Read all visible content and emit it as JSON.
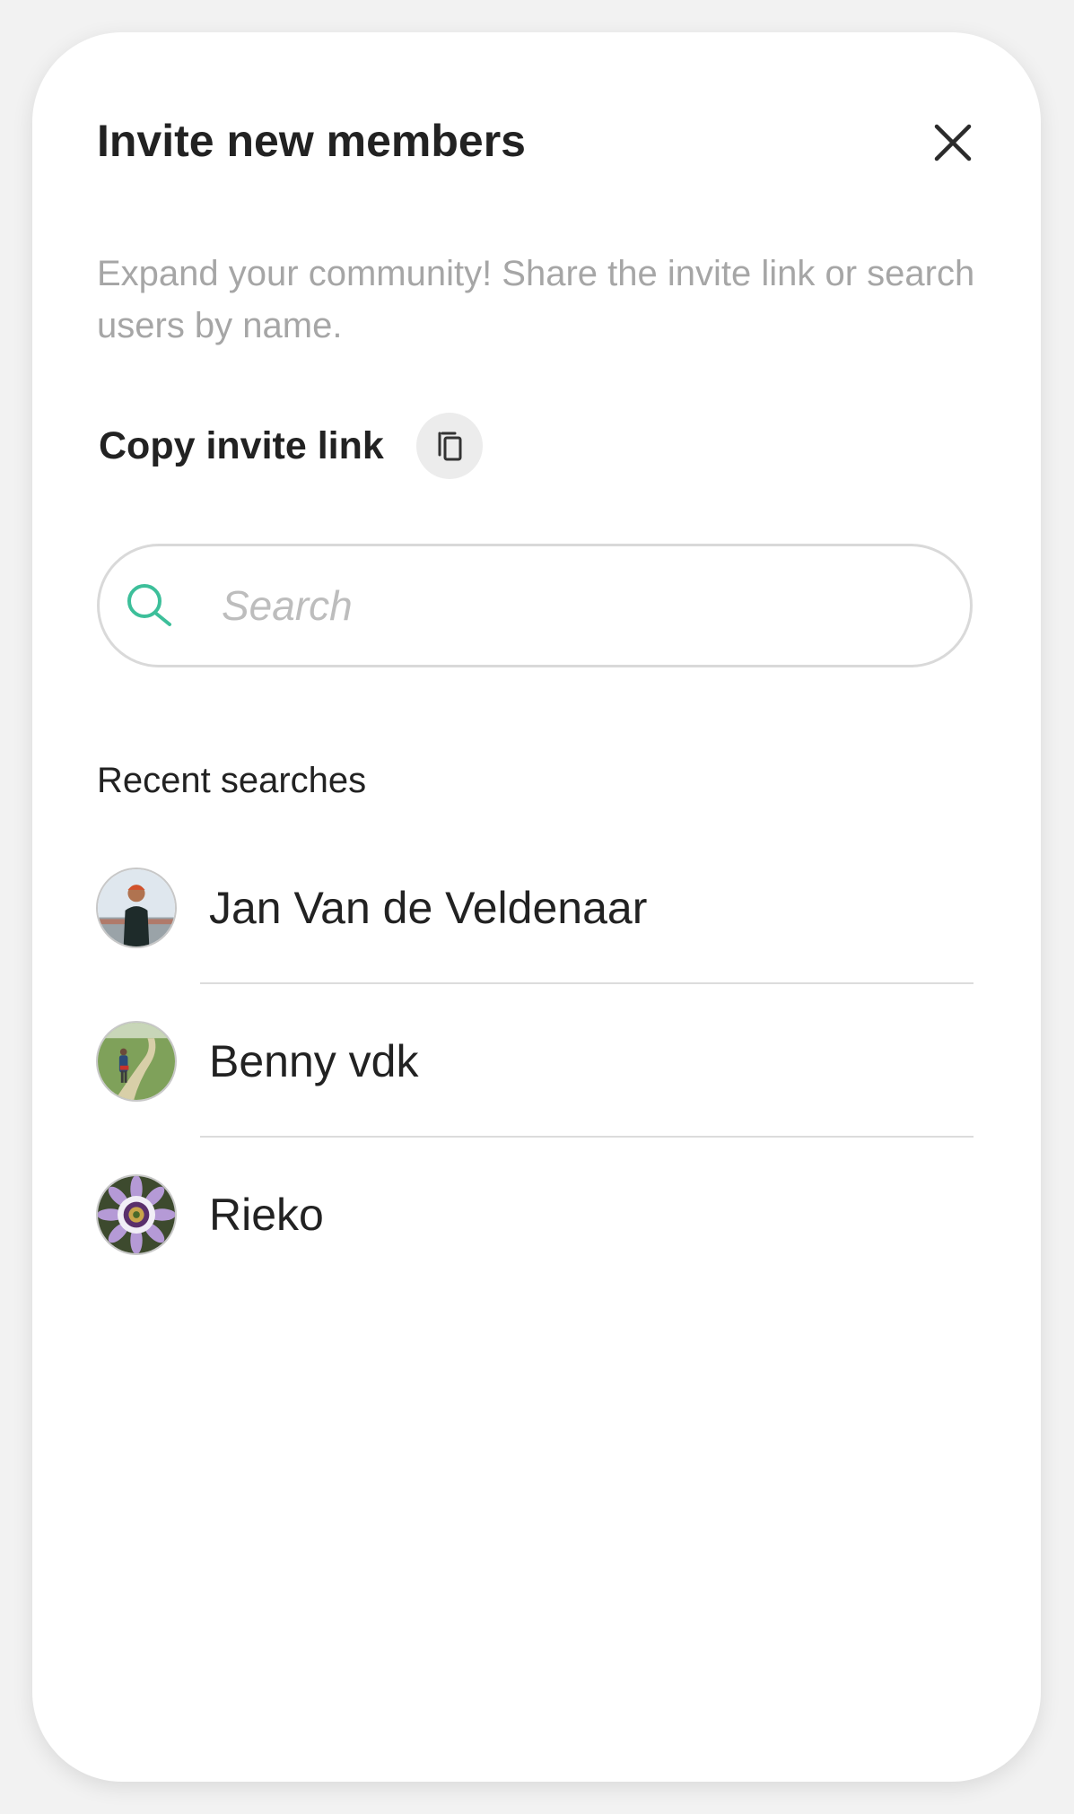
{
  "dialog": {
    "title": "Invite new members",
    "close_icon": "close-icon",
    "subtitle": "Expand your community! Share the invite link or search users by name."
  },
  "invite": {
    "copy_label": "Copy invite link",
    "copy_icon": "copy-icon"
  },
  "search": {
    "placeholder": "Search",
    "value": "",
    "icon": "search-icon",
    "accent_color": "#3dbf9a"
  },
  "recent": {
    "heading": "Recent searches",
    "items": [
      {
        "name": "Jan Van de Veldenaar",
        "avatar": "avatar-photo-man-standing"
      },
      {
        "name": "Benny vdk",
        "avatar": "avatar-photo-person-on-path"
      },
      {
        "name": "Rieko",
        "avatar": "avatar-photo-passion-flower"
      }
    ]
  }
}
